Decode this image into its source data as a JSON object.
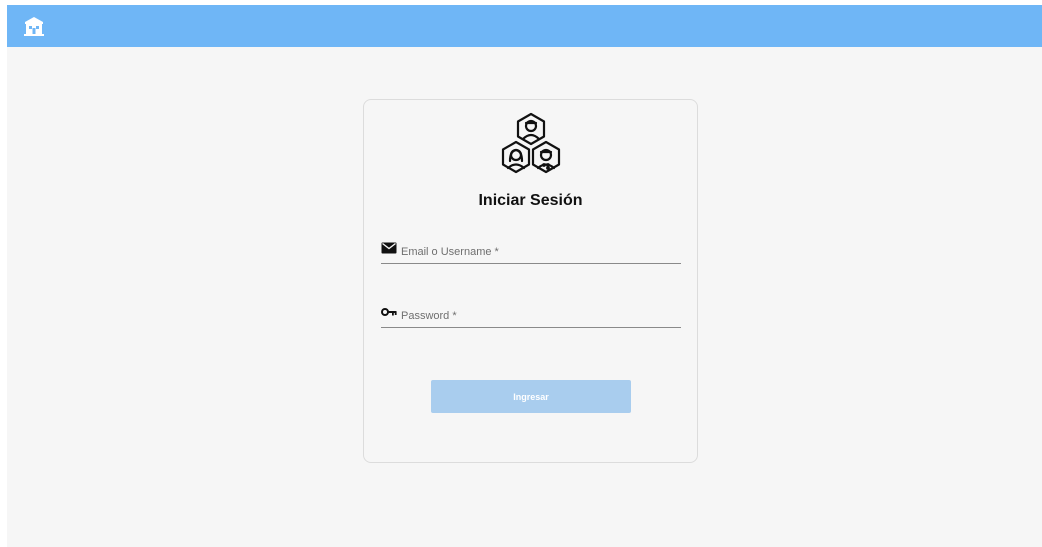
{
  "app_bar": {
    "icon": "building-icon",
    "color": "#6fb6f6"
  },
  "login_card": {
    "logo_icon": "team-hexagon-icon",
    "title": "Iniciar Sesión",
    "email_field": {
      "icon": "envelope-icon",
      "placeholder": "Email o Username *",
      "value": ""
    },
    "password_field": {
      "icon": "key-icon",
      "placeholder": "Password *",
      "value": ""
    },
    "submit_button": {
      "label": "Ingresar",
      "color": "#a9cdee"
    }
  }
}
